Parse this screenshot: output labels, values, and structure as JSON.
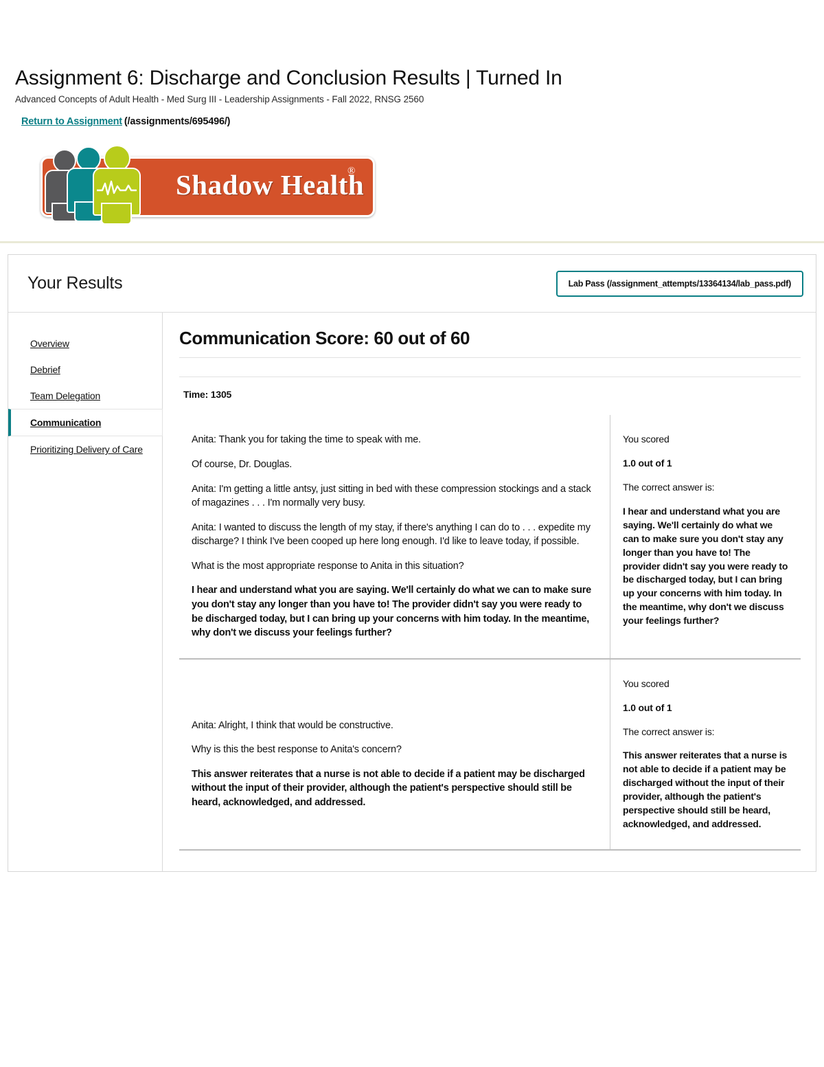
{
  "header": {
    "title": "Assignment 6: Discharge and Conclusion Results | Turned In",
    "subtitle": "Advanced Concepts of Adult Health - Med Surg III - Leadership Assignments - Fall 2022, RNSG 2560",
    "return_link_label": "Return to Assignment",
    "return_link_url_text": "(/assignments/695496/)"
  },
  "logo": {
    "brand_text": "Shadow Health",
    "registered_mark": "®",
    "colors": {
      "plate": "#d4522a",
      "figure_gray": "#58585a",
      "figure_teal": "#0b888d",
      "figure_green": "#b8cc1b"
    }
  },
  "results": {
    "title": "Your Results",
    "lab_pass_label": "Lab Pass (/assignment_attempts/13364134/lab_pass.pdf)",
    "accent_color": "#0b7f86"
  },
  "sidebar": {
    "items": [
      {
        "label": "Overview",
        "active": false
      },
      {
        "label": "Debrief",
        "active": false
      },
      {
        "label": "Team Delegation",
        "active": false
      },
      {
        "label": "Communication",
        "active": true
      },
      {
        "label": "Prioritizing Delivery of Care",
        "active": false
      }
    ]
  },
  "main": {
    "score_heading": "Communication Score: 60 out of 60",
    "time_label": "Time: 1305",
    "blocks": [
      {
        "transcript": [
          {
            "text": "Anita: Thank you for taking the time to speak with me.",
            "bold": false
          },
          {
            "text": "Of course, Dr. Douglas.",
            "bold": false
          },
          {
            "text": "Anita: I'm getting a little antsy, just sitting in bed with these compression stockings and a stack of magazines . . . I'm normally very busy.",
            "bold": false
          },
          {
            "text": "Anita: I wanted to discuss the length of my stay, if there's anything I can do to . . . expedite my discharge? I think I've been cooped up here long enough. I'd like to leave today, if possible.",
            "bold": false
          },
          {
            "text": "What is the most appropriate response to Anita in this situation?",
            "bold": false
          },
          {
            "text": "I hear and understand what you are saying. We'll certainly do what we can to make sure you don't stay any longer than you have to! The provider didn't say you were ready to be discharged today, but I can bring up your concerns with him today. In the meantime, why don't we discuss your feelings further?",
            "bold": true
          }
        ],
        "you_scored_label": "You scored",
        "score_value": "1.0 out of 1",
        "correct_answer_label": "The correct answer is:",
        "correct_answer_text": "I hear and understand what you are saying. We'll certainly do what we can to make sure you don't stay any longer than you have to! The provider didn't say you were ready to be discharged today, but I can bring up your concerns with him today. In the meantime, why don't we discuss your feelings further?"
      },
      {
        "transcript": [
          {
            "text": "Anita: Alright, I think that would be constructive.",
            "bold": false
          },
          {
            "text": "Why is this the best response to Anita's concern?",
            "bold": false
          },
          {
            "text": "This answer reiterates that a nurse is not able to decide if a patient may be discharged without the input of their provider, although the patient's perspective should still be heard, acknowledged, and addressed.",
            "bold": true
          }
        ],
        "you_scored_label": "You scored",
        "score_value": "1.0 out of 1",
        "correct_answer_label": "The correct answer is:",
        "correct_answer_text": "This answer reiterates that a nurse is not able to decide if a patient may be discharged without the input of their provider, although the patient's perspective should still be heard, acknowledged, and addressed."
      }
    ]
  }
}
